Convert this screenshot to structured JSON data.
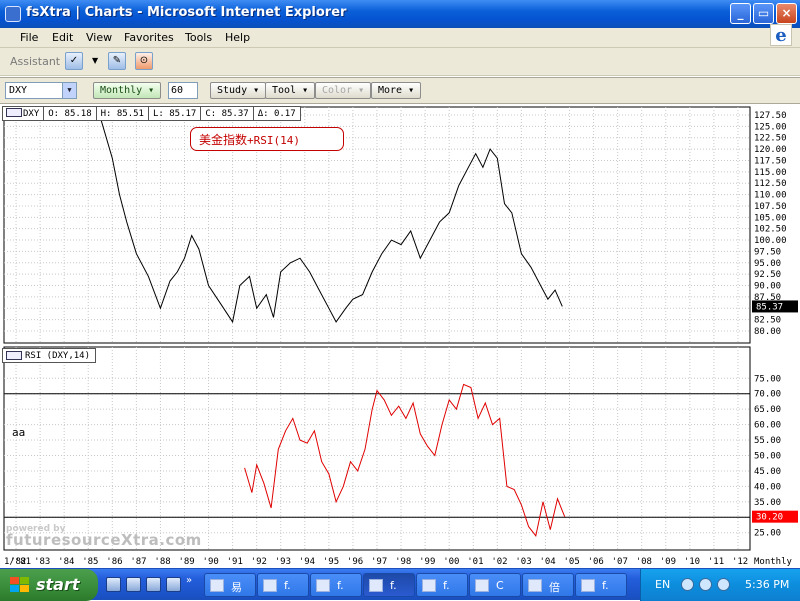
{
  "window": {
    "title": "fsXtra | Charts - Microsoft Internet Explorer"
  },
  "menu": [
    "File",
    "Edit",
    "View",
    "Favorites",
    "Tools",
    "Help"
  ],
  "toolbar": {
    "assistant_label": "Assistant"
  },
  "controls": {
    "symbol": "DXY",
    "interval": "Monthly",
    "periods": "60",
    "study": "Study",
    "tool": "Tool",
    "color": "Color",
    "more": "More"
  },
  "quote": {
    "symbol": "DXY",
    "open": "O: 85.18",
    "high": "H: 85.51",
    "low": "L: 85.17",
    "close": "C: 85.37",
    "change": "Δ: 0.17",
    "last_value": "85.37"
  },
  "annotation": {
    "cn_text": "美金指数",
    "en_text": "+RSI(14)"
  },
  "rsi": {
    "legend": "RSI (DXY,14)",
    "last_value": "30.20"
  },
  "side_note": "aa",
  "watermark": {
    "powered": "powered by",
    "brand": "futuresourceXtra.com"
  },
  "chart_data": [
    {
      "type": "line",
      "series": [
        {
          "x": [
            1985.5,
            1986.0,
            1986.3,
            1986.6,
            1987.0,
            1987.5,
            1988.0,
            1988.4,
            1988.7,
            1989.0,
            1989.3,
            1989.6,
            1990.0,
            1990.5,
            1991.0,
            1991.3,
            1991.7,
            1992.0,
            1992.4,
            1992.7,
            1993.0,
            1993.4,
            1993.8,
            1994.2,
            1994.6,
            1995.0,
            1995.3,
            1995.7,
            1996.0,
            1996.4,
            1996.8,
            1997.2,
            1997.6,
            1998.0,
            1998.4,
            1998.8,
            1999.2,
            1999.6,
            2000.0,
            2000.4,
            2000.8,
            2001.1,
            2001.4,
            2001.7,
            2002.0,
            2002.3,
            2002.6,
            2003.0,
            2003.4,
            2003.8,
            2004.1,
            2004.4,
            2004.7
          ],
          "y": [
            127.0,
            118.0,
            110.0,
            104.0,
            97.0,
            92.0,
            85.0,
            91.0,
            93.0,
            96.0,
            101.0,
            98.0,
            90.0,
            86.0,
            82.0,
            90.0,
            92.0,
            85.0,
            88.0,
            83.0,
            93.0,
            95.0,
            96.0,
            93.0,
            89.0,
            85.0,
            82.0,
            85.0,
            87.0,
            88.0,
            93.0,
            97.0,
            100.0,
            99.0,
            102.0,
            96.0,
            100.0,
            104.0,
            106.0,
            112.0,
            116.0,
            119.0,
            116.0,
            120.0,
            118.0,
            108.0,
            106.0,
            97.0,
            94.0,
            90.0,
            87.0,
            89.0,
            85.4
          ]
        }
      ],
      "yaxis_ticks": [
        "127.50",
        "125.00",
        "122.50",
        "120.00",
        "117.50",
        "115.00",
        "112.50",
        "110.00",
        "107.50",
        "105.00",
        "102.50",
        "100.00",
        "97.50",
        "95.00",
        "92.50",
        "90.00",
        "87.50",
        "85.00",
        "82.50",
        "80.00"
      ],
      "ylim": [
        80.0,
        127.5
      ],
      "xlim": [
        1981.5,
        2012.5
      ],
      "grid": true
    },
    {
      "type": "line",
      "series": [
        {
          "name": "RSI (DXY,14)",
          "x": [
            1991.5,
            1991.8,
            1992.0,
            1992.3,
            1992.6,
            1992.9,
            1993.2,
            1993.5,
            1993.8,
            1994.1,
            1994.4,
            1994.7,
            1995.0,
            1995.3,
            1995.6,
            1995.9,
            1996.2,
            1996.5,
            1996.8,
            1997.0,
            1997.3,
            1997.6,
            1997.9,
            1998.2,
            1998.5,
            1998.8,
            1999.1,
            1999.4,
            1999.7,
            2000.0,
            2000.3,
            2000.6,
            2000.9,
            2001.2,
            2001.5,
            2001.8,
            2002.1,
            2002.4,
            2002.7,
            2003.0,
            2003.3,
            2003.6,
            2003.9,
            2004.2,
            2004.5,
            2004.8
          ],
          "y": [
            46.0,
            38.0,
            47.0,
            41.0,
            33.0,
            52.0,
            58.0,
            62.0,
            55.0,
            54.0,
            58.0,
            48.0,
            44.0,
            35.0,
            40.0,
            48.0,
            45.0,
            52.0,
            65.0,
            71.0,
            68.0,
            63.0,
            66.0,
            62.0,
            67.0,
            57.0,
            53.0,
            50.0,
            60.0,
            68.0,
            65.0,
            73.0,
            72.0,
            62.0,
            67.0,
            60.0,
            62.0,
            40.0,
            39.0,
            34.0,
            27.0,
            24.0,
            35.0,
            26.0,
            36.0,
            30.2
          ]
        }
      ],
      "yaxis_ticks": [
        "75.00",
        "70.00",
        "65.00",
        "60.00",
        "55.00",
        "50.00",
        "45.00",
        "40.00",
        "35.00",
        "30.00",
        "25.00"
      ],
      "ylim": [
        22.0,
        78.0
      ],
      "reference_lines": [
        70,
        30
      ],
      "xlim": [
        1981.5,
        2012.5
      ],
      "grid": true
    }
  ],
  "xaxis": {
    "labels": [
      "1/'81",
      "'82",
      "'83",
      "'84",
      "'85",
      "'86",
      "'87",
      "'88",
      "'89",
      "'90",
      "'91",
      "'92",
      "'93",
      "'94",
      "'95",
      "'96",
      "'97",
      "'98",
      "'99",
      "'00",
      "'01",
      "'02",
      "'03",
      "'04",
      "'05",
      "'06",
      "'07",
      "'08",
      "'09",
      "'10",
      "'11",
      "'12"
    ],
    "interval_label": "Monthly"
  },
  "taskbar": {
    "start": "start",
    "tasks": [
      "易",
      "f.",
      "f.",
      "f.",
      "f.",
      "C",
      "倍",
      "f."
    ],
    "lang": "EN",
    "clock": "5:36 PM"
  },
  "colors": {
    "price_line": "#000000",
    "rsi_line": "#e00000",
    "last_value_bg": "#000000",
    "rsi_last_bg": "#ff0000",
    "grid": "#c8c8c8"
  }
}
